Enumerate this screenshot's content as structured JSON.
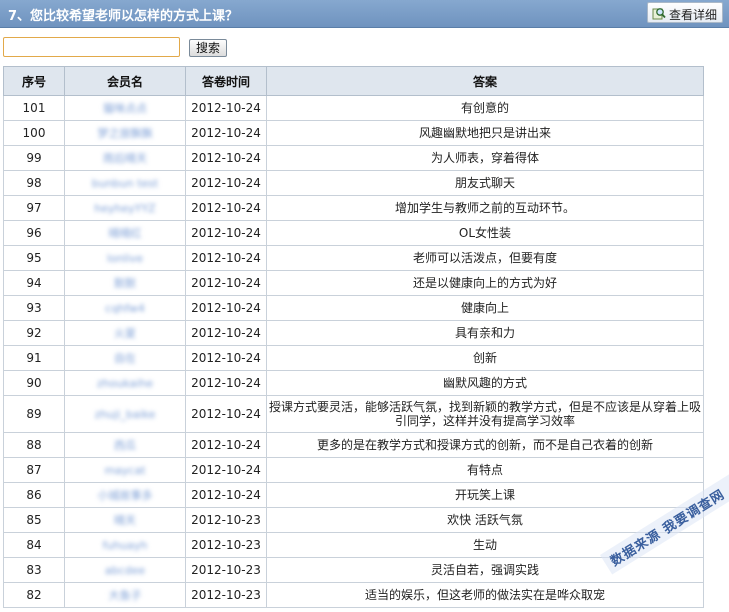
{
  "header": {
    "title": "7、您比较希望老师以怎样的方式上课？",
    "detail_label": "查看详细"
  },
  "search": {
    "value": "",
    "placeholder": "",
    "button_label": "搜索"
  },
  "table": {
    "columns": [
      "序号",
      "会员名",
      "答卷时间",
      "答案"
    ],
    "rows": [
      {
        "id": "101",
        "member": "猫咪点点",
        "time": "2012-10-24",
        "answer": "有创意的"
      },
      {
        "id": "100",
        "member": "梦之旅飘飘",
        "time": "2012-10-24",
        "answer": "风趣幽默地把只是讲出来"
      },
      {
        "id": "99",
        "member": "雨后晴天",
        "time": "2012-10-24",
        "answer": "为人师表，穿着得体"
      },
      {
        "id": "98",
        "member": "bunbun test",
        "time": "2012-10-24",
        "answer": "朋友式聊天"
      },
      {
        "id": "97",
        "member": "heyheyYYZ",
        "time": "2012-10-24",
        "answer": "增加学生与教师之前的互动环节。"
      },
      {
        "id": "96",
        "member": "晴晴红",
        "time": "2012-10-24",
        "answer": "OL女性装"
      },
      {
        "id": "95",
        "member": "lonlive",
        "time": "2012-10-24",
        "answer": "老师可以活泼点，但要有度"
      },
      {
        "id": "94",
        "member": "默默",
        "time": "2012-10-24",
        "answer": "还是以健康向上的方式为好"
      },
      {
        "id": "93",
        "member": "cqhfw4",
        "time": "2012-10-24",
        "answer": "健康向上"
      },
      {
        "id": "92",
        "member": "火夏",
        "time": "2012-10-24",
        "answer": "具有亲和力"
      },
      {
        "id": "91",
        "member": "自在",
        "time": "2012-10-24",
        "answer": "创新"
      },
      {
        "id": "90",
        "member": "zhoukaihe",
        "time": "2012-10-24",
        "answer": "幽默风趣的方式"
      },
      {
        "id": "89",
        "member": "zhuji_baike",
        "time": "2012-10-24",
        "answer": "授课方式要灵活，能够活跃气氛，找到新颖的教学方式，但是不应该是从穿着上吸引同学，这样并没有提高学习效率"
      },
      {
        "id": "88",
        "member": "西瓜",
        "time": "2012-10-24",
        "answer": "更多的是在教学方式和授课方式的创新，而不是自己衣着的创新"
      },
      {
        "id": "87",
        "member": "maycat",
        "time": "2012-10-24",
        "answer": "有特点"
      },
      {
        "id": "86",
        "member": "小城故事多",
        "time": "2012-10-24",
        "answer": "开玩笑上课"
      },
      {
        "id": "85",
        "member": "晴天",
        "time": "2012-10-23",
        "answer": "欢快  活跃气氛"
      },
      {
        "id": "84",
        "member": "fuhuayh",
        "time": "2012-10-23",
        "answer": "生动"
      },
      {
        "id": "83",
        "member": "abcdee",
        "time": "2012-10-23",
        "answer": "灵活自若，强调实践"
      },
      {
        "id": "82",
        "member": "大鱼子",
        "time": "2012-10-23",
        "answer": "适当的娱乐，但这老师的做法实在是哗众取宠"
      }
    ]
  },
  "watermark": "数据来源  我要调查网",
  "colors": {
    "header_bg": "#7b9dc7",
    "table_header_bg": "#dfe6ee",
    "border": "#c9d1da",
    "blurred_member": "#7d9fd6",
    "search_focus_border": "#e2a94a"
  },
  "icons": {
    "detail": "magnifier-icon"
  }
}
